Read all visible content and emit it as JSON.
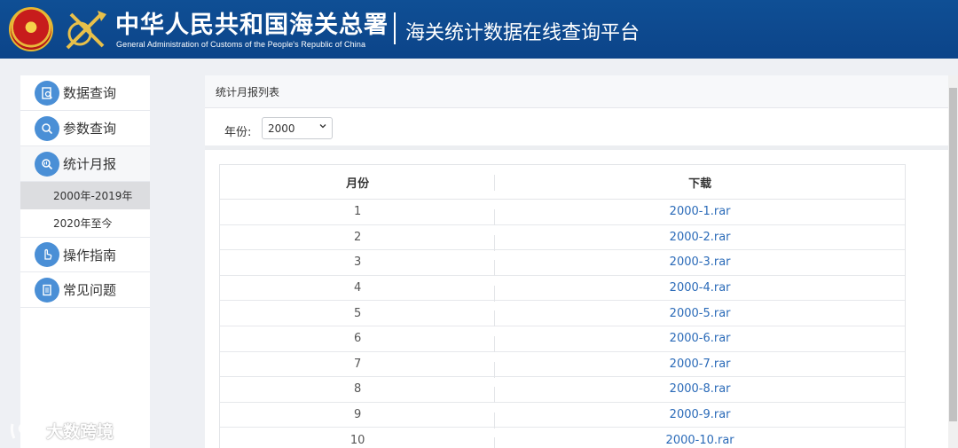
{
  "header": {
    "org_title": "中华人民共和国海关总署",
    "org_subtitle": "General Administration of Customs of the People's Republic of China",
    "platform_title": "海关统计数据在线查询平台"
  },
  "sidebar": {
    "items": [
      {
        "label": "数据查询",
        "icon": "data-query-icon"
      },
      {
        "label": "参数查询",
        "icon": "parameter-query-icon"
      },
      {
        "label": "统计月报",
        "icon": "monthly-report-icon"
      },
      {
        "label": "操作指南",
        "icon": "hand-pointer-icon"
      },
      {
        "label": "常见问题",
        "icon": "faq-document-icon"
      }
    ],
    "subitems": [
      {
        "label": "2000年-2019年"
      },
      {
        "label": "2020年至今"
      }
    ]
  },
  "main": {
    "panel_title": "统计月报列表",
    "filter": {
      "label": "年份:",
      "selected_year": "2000"
    },
    "table": {
      "headers": [
        "月份",
        "下载"
      ],
      "rows": [
        {
          "month": "1",
          "file": "2000-1.rar"
        },
        {
          "month": "2",
          "file": "2000-2.rar"
        },
        {
          "month": "3",
          "file": "2000-3.rar"
        },
        {
          "month": "4",
          "file": "2000-4.rar"
        },
        {
          "month": "5",
          "file": "2000-5.rar"
        },
        {
          "month": "6",
          "file": "2000-6.rar"
        },
        {
          "month": "7",
          "file": "2000-7.rar"
        },
        {
          "month": "8",
          "file": "2000-8.rar"
        },
        {
          "month": "9",
          "file": "2000-9.rar"
        },
        {
          "month": "10",
          "file": "2000-10.rar"
        }
      ]
    }
  },
  "watermark": {
    "text": "大数跨境"
  },
  "colors": {
    "header_bg": "#0f4f95",
    "icon_blue": "#4a8fd6",
    "link": "#2a6ab8",
    "selected_sub_bg": "#dcdde0"
  }
}
